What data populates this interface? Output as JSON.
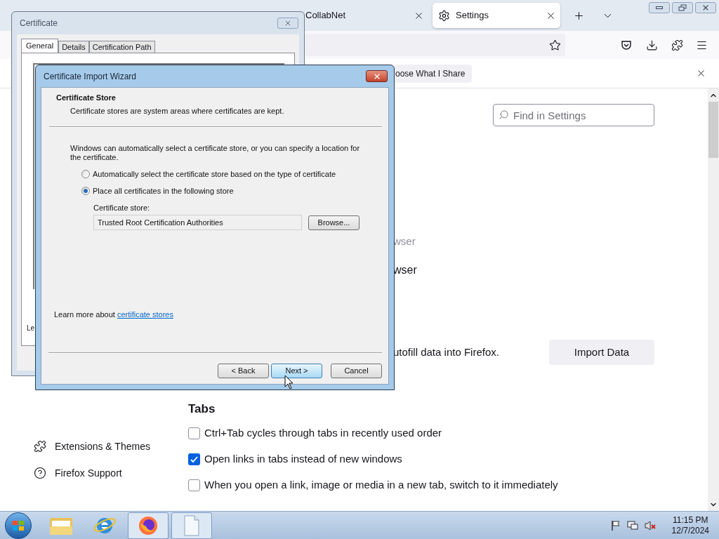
{
  "browser": {
    "tabs": [
      {
        "label": "CollabNet",
        "selected": false
      },
      {
        "label": "Settings",
        "selected": true
      }
    ],
    "notification": {
      "button": "oose What I Share"
    },
    "search": {
      "placeholder": "Find in Settings"
    },
    "fragments": [
      {
        "text": "wser",
        "kind": "muted"
      },
      {
        "text": "wser",
        "kind": "label"
      }
    ],
    "import": {
      "text": "utofill data into Firefox.",
      "button": "Import Data"
    },
    "tabs_section": {
      "heading": "Tabs",
      "options": [
        {
          "label": "Ctrl+Tab cycles through tabs in recently used order",
          "checked": false
        },
        {
          "label": "Open links in tabs instead of new windows",
          "checked": true
        },
        {
          "label": "When you open a link, image or media in a new tab, switch to it immediately",
          "checked": false
        }
      ]
    },
    "sidebar": {
      "items": [
        {
          "label": "Extensions & Themes",
          "kind": "extensions"
        },
        {
          "label": "Firefox Support",
          "kind": "support"
        }
      ]
    }
  },
  "certificate_dialog": {
    "title": "Certificate",
    "tabs": [
      {
        "label": "General",
        "selected": true
      },
      {
        "label": "Details",
        "selected": false
      },
      {
        "label": "Certification Path",
        "selected": false
      }
    ],
    "fragment": "Le"
  },
  "wizard": {
    "title": "Certificate Import Wizard",
    "section_title": "Certificate Store",
    "section_subtitle": "Certificate stores are system areas where certificates are kept.",
    "description": "Windows can automatically select a certificate store, or you can specify a location for the certificate.",
    "options": [
      {
        "label": "Automatically select the certificate store based on the type of certificate",
        "selected": false
      },
      {
        "label": "Place all certificates in the following store",
        "selected": true
      }
    ],
    "store_label": "Certificate store:",
    "store_value": "Trusted Root Certification Authorities",
    "browse": "Browse...",
    "learn_more": {
      "text": "Learn more about",
      "link": "certificate stores"
    },
    "buttons": [
      {
        "label": "< Back",
        "hovered": false
      },
      {
        "label": "Next >",
        "hovered": true
      },
      {
        "label": "Cancel",
        "hovered": false
      }
    ]
  },
  "taskbar": {
    "apps": [
      {
        "kind": "explorer",
        "active": false
      },
      {
        "kind": "ie",
        "active": false
      },
      {
        "kind": "firefox",
        "active": true
      },
      {
        "kind": "document",
        "active": true
      }
    ],
    "time": "11:15 PM",
    "date": "12/7/2024"
  }
}
